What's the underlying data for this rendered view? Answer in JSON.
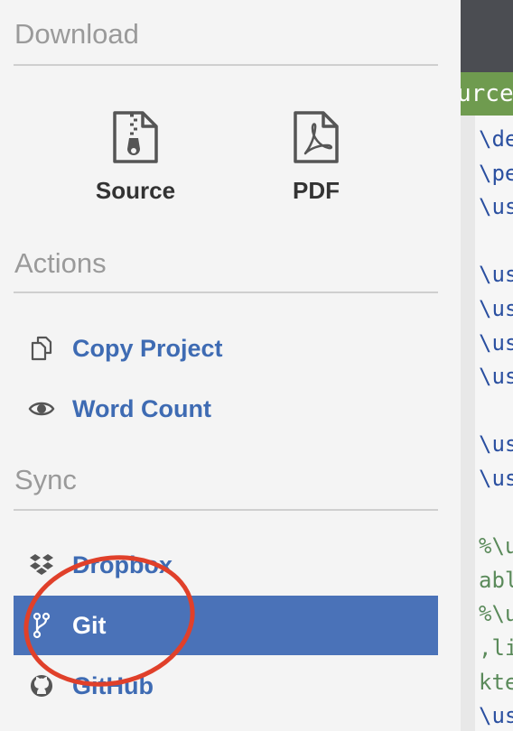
{
  "download": {
    "title": "Download",
    "items": [
      {
        "label": "Source",
        "icon": "zip-file-icon"
      },
      {
        "label": "PDF",
        "icon": "pdf-file-icon"
      }
    ]
  },
  "actions": {
    "title": "Actions",
    "items": [
      {
        "label": "Copy Project",
        "icon": "copy-icon"
      },
      {
        "label": "Word Count",
        "icon": "eye-icon"
      }
    ]
  },
  "sync": {
    "title": "Sync",
    "items": [
      {
        "label": "Dropbox",
        "icon": "dropbox-icon"
      },
      {
        "label": "Git",
        "icon": "git-branch-icon",
        "active": true
      },
      {
        "label": "GitHub",
        "icon": "github-icon"
      }
    ]
  },
  "editor": {
    "tab_label": "urce",
    "lines": [
      "\\de",
      "\\pe",
      "\\us",
      "",
      "\\us",
      "\\us",
      "\\us",
      "\\us",
      "",
      "\\us",
      "\\us",
      "",
      "%\\u",
      "abl",
      "%\\u",
      ",li",
      "kte",
      "\\us"
    ]
  },
  "colors": {
    "accent": "#4a72b8",
    "link": "#3e6bb3",
    "annotation": "#e0402a",
    "code_command": "#2a4fa0",
    "code_comment": "#5a8a5a"
  }
}
